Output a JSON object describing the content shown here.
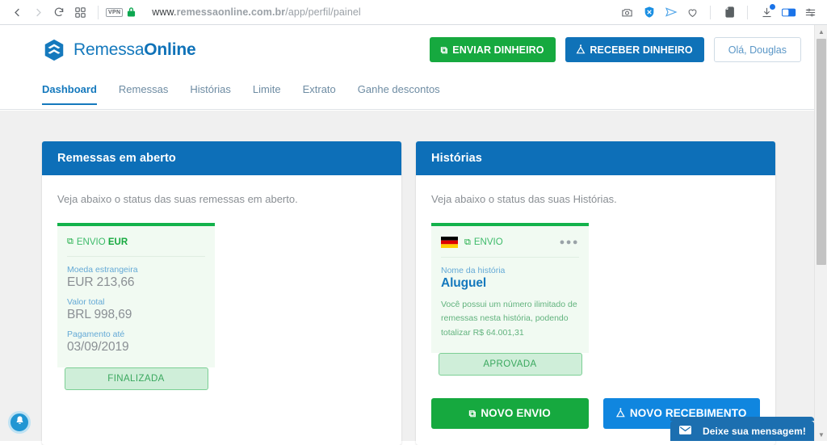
{
  "browser": {
    "back_icon": "back-arrow-icon",
    "forward_icon": "forward-arrow-icon",
    "reload_icon": "reload-icon",
    "apps_icon": "apps-grid-icon",
    "vpn_label": "VPN",
    "lock_icon": "padlock-icon",
    "url_host_prefix": "www.",
    "url_host_bold": "remessaonline.com.br",
    "url_path": "/app/perfil/painel",
    "extensions": [
      {
        "name": "screenshot-icon",
        "glyph": "὏7"
      },
      {
        "name": "shield-blocker-icon",
        "glyph": "✖"
      },
      {
        "name": "send-telegram-icon",
        "glyph": "➤"
      },
      {
        "name": "heart-icon",
        "glyph": "♡"
      },
      {
        "name": "evernote-icon",
        "glyph": "ὁ8"
      },
      {
        "name": "download-icon",
        "glyph": "⤓"
      },
      {
        "name": "tab-toggle-icon",
        "glyph": "▬"
      },
      {
        "name": "settings-menu-icon",
        "glyph": "≡"
      }
    ]
  },
  "header": {
    "logo_text_light": "Remessa",
    "logo_text_bold": "Online",
    "send_money_label": "ENVIAR DINHEIRO",
    "receive_money_label": "RECEBER DINHEIRO",
    "greeting_label": "Olá, Douglas"
  },
  "nav": {
    "tabs": [
      {
        "label": "Dashboard",
        "active": true
      },
      {
        "label": "Remessas",
        "active": false
      },
      {
        "label": "Histórias",
        "active": false
      },
      {
        "label": "Limite",
        "active": false
      },
      {
        "label": "Extrato",
        "active": false
      },
      {
        "label": "Ganhe descontos",
        "active": false
      }
    ]
  },
  "remittances_card": {
    "title": "Remessas em aberto",
    "description": "Veja abaixo o status das suas remessas em aberto.",
    "item": {
      "direction_label": "ENVIO",
      "currency_code": "EUR",
      "fields": [
        {
          "label": "Moeda estrangeira",
          "value": "EUR 213,66"
        },
        {
          "label": "Valor total",
          "value": "BRL 998,69"
        },
        {
          "label": "Pagamento até",
          "value": "03/09/2019"
        }
      ],
      "status": "FINALIZADA"
    }
  },
  "stories_card": {
    "title": "Histórias",
    "description": "Veja abaixo o status das suas Histórias.",
    "item": {
      "flag": "germany-flag-icon",
      "direction_label": "ENVIO",
      "menu_icon": "more-options-icon",
      "name_label": "Nome da história",
      "name_value": "Aluguel",
      "body_text": "Você possui um número ilimitado de remessas nesta história, podendo totalizar R$ 64.001,31",
      "status": "APROVADA"
    },
    "new_send_label": "NOVO ENVIO",
    "new_receive_label": "NOVO RECEBIMENTO"
  },
  "widgets": {
    "bell_icon": "notification-bell-icon",
    "chat_label": "Deixe sua mensagem!",
    "chat_icon": "envelope-icon"
  },
  "colors": {
    "brand_blue": "#0d6fb8",
    "brand_green": "#16a93f",
    "accent_blue": "#1579bd",
    "page_bg": "#f0f0f0"
  }
}
